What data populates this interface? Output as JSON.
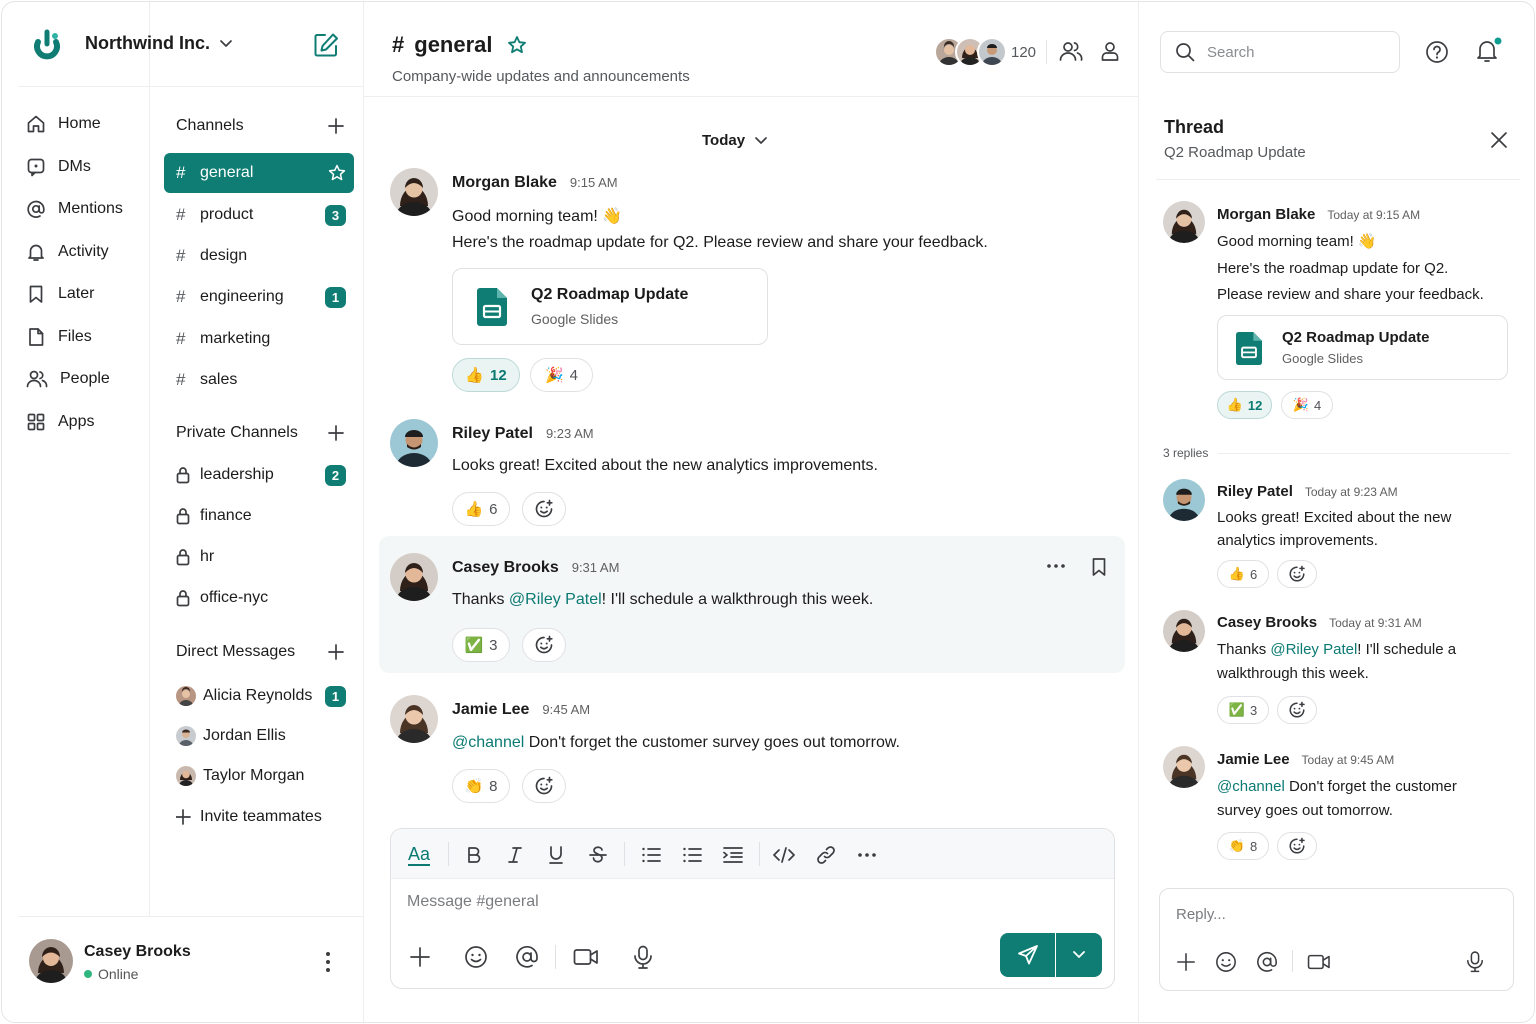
{
  "workspace": {
    "name": "Northwind Inc."
  },
  "nav": [
    {
      "label": "Home",
      "icon": "home-icon"
    },
    {
      "label": "DMs",
      "icon": "dm-icon"
    },
    {
      "label": "Mentions",
      "icon": "at-icon"
    },
    {
      "label": "Activity",
      "icon": "bell-icon"
    },
    {
      "label": "Later",
      "icon": "bookmark-icon"
    },
    {
      "label": "Files",
      "icon": "file-icon"
    },
    {
      "label": "People",
      "icon": "people-icon"
    },
    {
      "label": "Apps",
      "icon": "apps-icon"
    }
  ],
  "sidebar": {
    "channels_title": "Channels",
    "channels": [
      {
        "name": "general",
        "badge": ""
      },
      {
        "name": "product",
        "badge": "3"
      },
      {
        "name": "design",
        "badge": ""
      },
      {
        "name": "engineering",
        "badge": "1"
      },
      {
        "name": "marketing",
        "badge": ""
      },
      {
        "name": "sales",
        "badge": ""
      }
    ],
    "private_title": "Private Channels",
    "private": [
      {
        "name": "leadership",
        "badge": "2"
      },
      {
        "name": "finance",
        "badge": ""
      },
      {
        "name": "hr",
        "badge": ""
      },
      {
        "name": "office-nyc",
        "badge": ""
      }
    ],
    "dm_title": "Direct Messages",
    "dms": [
      {
        "name": "Alicia Reynolds",
        "badge": "1"
      },
      {
        "name": "Jordan Ellis",
        "badge": ""
      },
      {
        "name": "Taylor Morgan",
        "badge": ""
      }
    ],
    "invite": "Invite teammates"
  },
  "user": {
    "name": "Casey Brooks",
    "status": "Online"
  },
  "channel": {
    "hash": "#",
    "name": "general",
    "description": "Company-wide updates and announcements",
    "member_count": "120"
  },
  "date_divider": "Today",
  "messages": [
    {
      "author": "Morgan Blake",
      "time": "9:15 AM",
      "line1": "Good morning team! 👋",
      "line2": "Here's the roadmap update for Q2. Please review and share your feedback.",
      "attachment": {
        "title": "Q2 Roadmap Update",
        "subtitle": "Google Slides"
      },
      "reactions": [
        {
          "emoji": "👍",
          "count": "12"
        },
        {
          "emoji": "🎉",
          "count": "4"
        }
      ]
    },
    {
      "author": "Riley Patel",
      "time": "9:23 AM",
      "line1": "Looks great! Excited about the new analytics improvements.",
      "reactions": [
        {
          "emoji": "👍",
          "count": "6"
        }
      ]
    },
    {
      "author": "Casey Brooks",
      "time": "9:31 AM",
      "pre": "Thanks ",
      "mention": "@Riley Patel",
      "post": "! I'll schedule a walkthrough this week.",
      "reactions": [
        {
          "emoji": "✅",
          "count": "3"
        }
      ]
    },
    {
      "author": "Jamie Lee",
      "time": "9:45 AM",
      "mention": "@channel",
      "post": " Don't forget the customer survey goes out tomorrow.",
      "reactions": [
        {
          "emoji": "👏",
          "count": "8"
        }
      ]
    }
  ],
  "composer": {
    "placeholder": "Message #general",
    "format_label": "Aa"
  },
  "search": {
    "placeholder": "Search"
  },
  "thread": {
    "title": "Thread",
    "subtitle": "Q2 Roadmap Update",
    "root": {
      "author": "Morgan Blake",
      "time": "Today at 9:15 AM",
      "line1": "Good morning team! 👋",
      "line2": "Here's the roadmap update for Q2.",
      "line3": "Please review and share your feedback.",
      "attachment": {
        "title": "Q2 Roadmap Update",
        "subtitle": "Google Slides"
      },
      "reactions": [
        {
          "emoji": "👍",
          "count": "12"
        },
        {
          "emoji": "🎉",
          "count": "4"
        }
      ]
    },
    "replies_label": "3 replies",
    "replies": [
      {
        "author": "Riley Patel",
        "time": "Today at 9:23 AM",
        "line1": "Looks great! Excited about the new",
        "line2": "analytics improvements.",
        "reactions": [
          {
            "emoji": "👍",
            "count": "6"
          }
        ]
      },
      {
        "author": "Casey Brooks",
        "time": "Today at 9:31 AM",
        "pre": "Thanks ",
        "mention": "@Riley Patel",
        "post": "! I'll schedule a",
        "line2": "walkthrough this week.",
        "reactions": [
          {
            "emoji": "✅",
            "count": "3"
          }
        ]
      },
      {
        "author": "Jamie Lee",
        "time": "Today at 9:45 AM",
        "mention": "@channel",
        "post": " Don't forget the customer",
        "line2": "survey goes out tomorrow.",
        "reactions": [
          {
            "emoji": "👏",
            "count": "8"
          }
        ]
      }
    ],
    "reply_placeholder": "Reply..."
  },
  "colors": {
    "accent": "#0f7d73",
    "mention": "#0b7a72"
  }
}
